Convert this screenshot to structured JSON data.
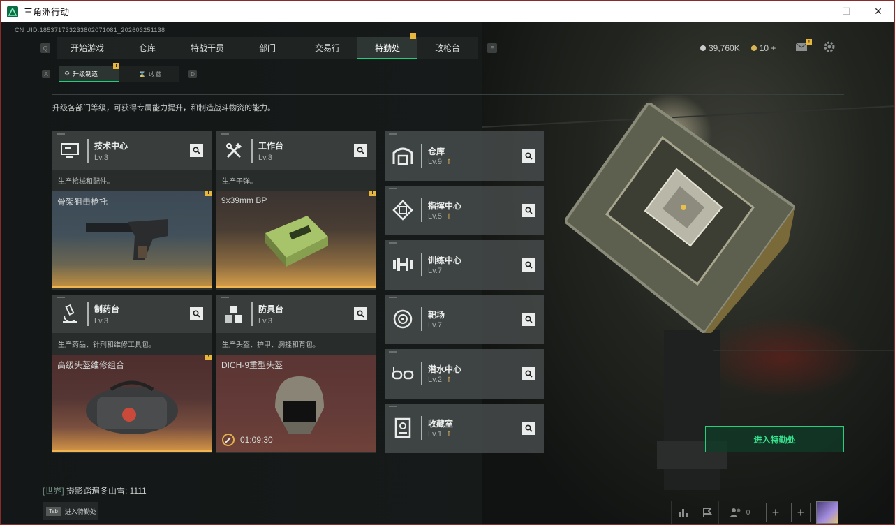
{
  "window": {
    "title": "三角洲行动",
    "minimize": "—",
    "maximize": "☐",
    "close": "✕"
  },
  "uid": "CN UID:185371733233802071081_202603251138",
  "nav": {
    "left_key": "Q",
    "right_key": "E",
    "tabs": [
      {
        "label": "开始游戏",
        "active": false,
        "badge": false
      },
      {
        "label": "仓库",
        "active": false,
        "badge": false
      },
      {
        "label": "特战干员",
        "active": false,
        "badge": false
      },
      {
        "label": "部门",
        "active": false,
        "badge": false
      },
      {
        "label": "交易行",
        "active": false,
        "badge": false
      },
      {
        "label": "特勤处",
        "active": true,
        "badge": true
      },
      {
        "label": "改枪台",
        "active": false,
        "badge": false
      }
    ],
    "badge_text": "!"
  },
  "currency": {
    "coins": "39,760K",
    "tickets": "10 +"
  },
  "subtabs": {
    "left_key": "A",
    "right_key": "D",
    "items": [
      {
        "label": "升级制造",
        "active": true
      },
      {
        "label": "收藏",
        "active": false
      }
    ]
  },
  "description": "升级各部门等级，可获得专属能力提升，和制造战斗物资的能力。",
  "workshops": [
    {
      "name": "技术中心",
      "level": "Lv.3",
      "desc": "生产枪械和配件。",
      "product": "骨架狙击枪托",
      "icon": "computer-icon"
    },
    {
      "name": "工作台",
      "level": "Lv.3",
      "desc": "生产子弹。",
      "product": "9x39mm BP",
      "icon": "tools-icon"
    },
    {
      "name": "制药台",
      "level": "Lv.3",
      "desc": "生产药品、针剂和维修工具包。",
      "product": "高级头盔维修组合",
      "icon": "microscope-icon"
    },
    {
      "name": "防具台",
      "level": "Lv.3",
      "desc": "生产头盔、护甲、胸挂和背包。",
      "product": "DICH-9重型头盔",
      "icon": "cubes-icon",
      "timer": "01:09:30"
    }
  ],
  "departments": [
    {
      "name": "仓库",
      "level": "Lv.9",
      "icon": "warehouse-icon"
    },
    {
      "name": "指挥中心",
      "level": "Lv.5",
      "icon": "command-icon"
    },
    {
      "name": "训练中心",
      "level": "Lv.7",
      "icon": "dumbbell-icon"
    },
    {
      "name": "靶场",
      "level": "Lv.7",
      "icon": "target-icon"
    },
    {
      "name": "潜水中心",
      "level": "Lv.2",
      "icon": "goggles-icon"
    },
    {
      "name": "收藏室",
      "level": "Lv.1",
      "icon": "collection-icon"
    }
  ],
  "enter_button": "进入特勤处",
  "chat": {
    "channel": "[世界]",
    "message": " 摄影踏遍冬山雪: 1111"
  },
  "tab_hint": {
    "key": "Tab",
    "label": "进入特勤处"
  },
  "friends_count": "0",
  "colors": {
    "accent": "#1fd07a",
    "badge": "#e8b63c"
  }
}
